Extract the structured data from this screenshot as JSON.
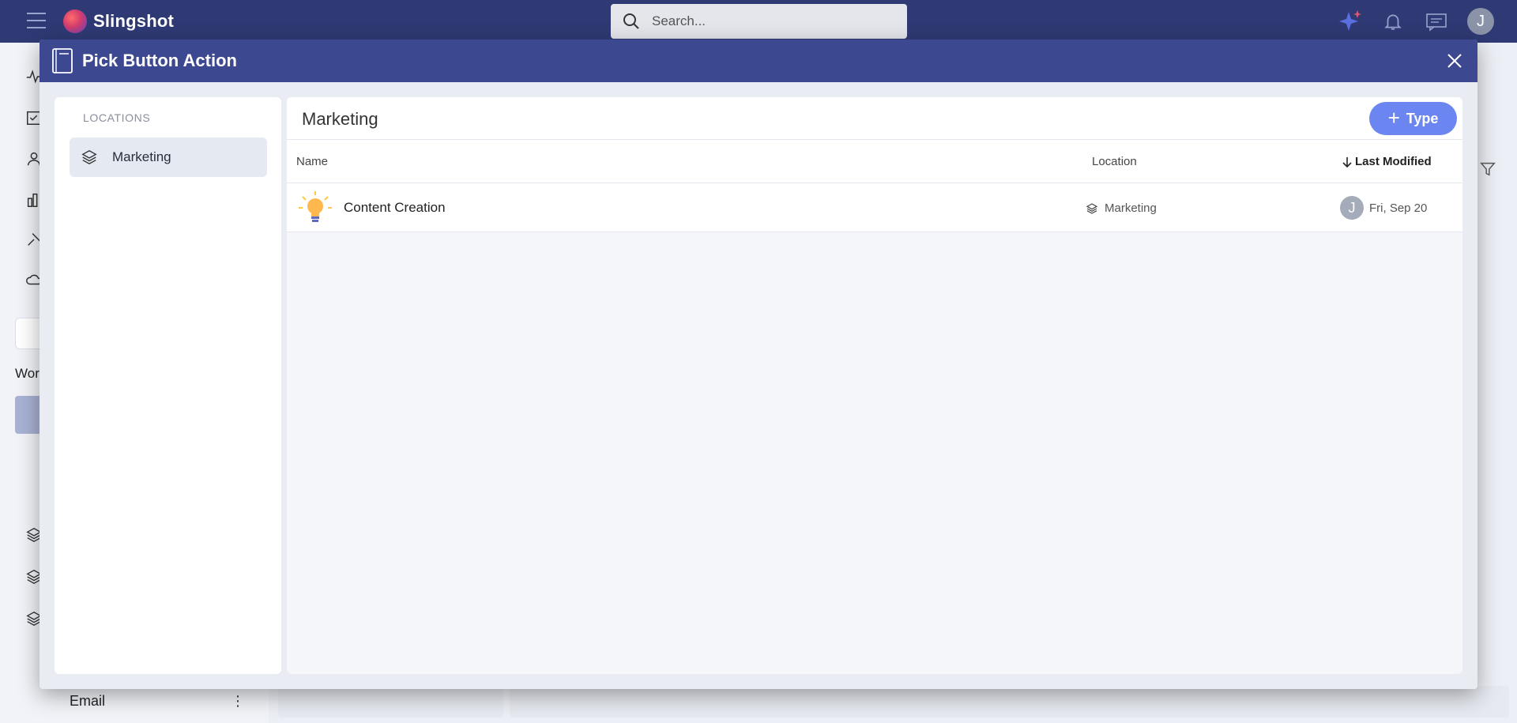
{
  "app": {
    "name": "Slingshot",
    "search_placeholder": "Search...",
    "user_initial": "J"
  },
  "background": {
    "workspace_partial": "Wor",
    "email_item": "Email"
  },
  "modal": {
    "title": "Pick Button Action",
    "locations_heading": "LOCATIONS",
    "locations": [
      {
        "label": "Marketing",
        "selected": true
      }
    ],
    "content": {
      "title": "Marketing",
      "add_button_label": "Type",
      "columns": {
        "name": "Name",
        "location": "Location",
        "last_modified": "Last Modified"
      },
      "rows": [
        {
          "name": "Content Creation",
          "location": "Marketing",
          "modified_by_initial": "J",
          "modified": "Fri, Sep 20"
        }
      ]
    }
  },
  "colors": {
    "topbar": "#2f3a75",
    "modal_header": "#3c4890",
    "accent_button": "#6b86f0"
  }
}
